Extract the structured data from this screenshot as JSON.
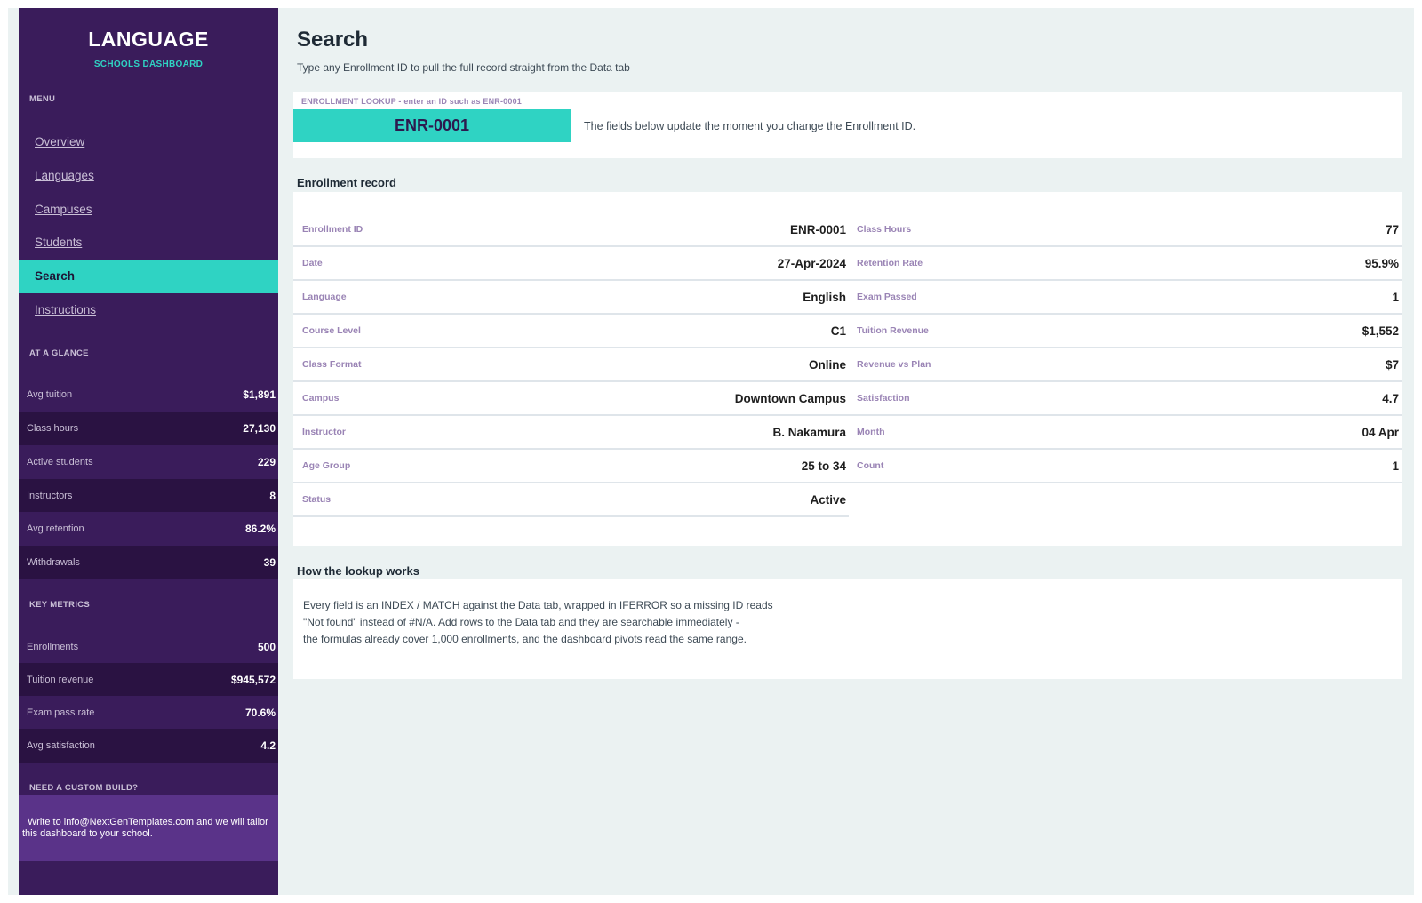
{
  "brand": {
    "title": "LANGUAGE",
    "subtitle": "SCHOOLS DASHBOARD"
  },
  "sidebar": {
    "menu_label": "MENU",
    "items": [
      {
        "label": "Overview"
      },
      {
        "label": "Languages"
      },
      {
        "label": "Campuses"
      },
      {
        "label": "Students"
      },
      {
        "label": "Search",
        "active": true
      },
      {
        "label": "Instructions"
      }
    ],
    "glance_label": "AT A GLANCE",
    "glance": [
      {
        "label": "Avg tuition",
        "value": "$1,891"
      },
      {
        "label": "Class hours",
        "value": "27,130"
      },
      {
        "label": "Active students",
        "value": "229"
      },
      {
        "label": "Instructors",
        "value": "8"
      },
      {
        "label": "Avg retention",
        "value": "86.2%"
      },
      {
        "label": "Withdrawals",
        "value": "39"
      }
    ],
    "metrics_label": "KEY METRICS",
    "metrics": [
      {
        "label": "Enrollments",
        "value": "500"
      },
      {
        "label": "Tuition revenue",
        "value": "$945,572"
      },
      {
        "label": "Exam pass rate",
        "value": "70.6%"
      },
      {
        "label": "Avg satisfaction",
        "value": "4.2"
      }
    ],
    "cta_label": "NEED A CUSTOM BUILD?",
    "cta_line1": "Write to info@NextGenTemplates.com and we will tailor",
    "cta_line2": "this dashboard to your school."
  },
  "main": {
    "title": "Search",
    "subtitle": "Type any Enrollment ID to pull the full record straight from the Data tab",
    "lookup": {
      "label": "ENROLLMENT LOOKUP  -  enter an ID such as ENR-0001",
      "value": "ENR-0001",
      "hint": "The fields below update the moment you change the Enrollment ID."
    },
    "record_title": "Enrollment record",
    "record_left": [
      {
        "label": "Enrollment ID",
        "value": "ENR-0001"
      },
      {
        "label": "Date",
        "value": "27-Apr-2024"
      },
      {
        "label": "Language",
        "value": "English"
      },
      {
        "label": "Course Level",
        "value": "C1"
      },
      {
        "label": "Class Format",
        "value": "Online"
      },
      {
        "label": "Campus",
        "value": "Downtown Campus"
      },
      {
        "label": "Instructor",
        "value": "B. Nakamura"
      },
      {
        "label": "Age Group",
        "value": "25 to 34"
      },
      {
        "label": "Status",
        "value": "Active"
      }
    ],
    "record_right": [
      {
        "label": "Class Hours",
        "value": "77"
      },
      {
        "label": "Retention Rate",
        "value": "95.9%"
      },
      {
        "label": "Exam Passed",
        "value": "1"
      },
      {
        "label": "Tuition Revenue",
        "value": "$1,552"
      },
      {
        "label": "Revenue vs Plan",
        "value": "$7"
      },
      {
        "label": "Satisfaction",
        "value": "4.7"
      },
      {
        "label": "Month",
        "value": "04 Apr"
      },
      {
        "label": "Count",
        "value": "1"
      }
    ],
    "how_title": "How the lookup works",
    "how_lines": [
      "Every field is an INDEX / MATCH against the Data tab, wrapped in IFERROR so a missing ID reads",
      "\"Not found\" instead of #N/A. Add rows to the Data tab and they are searchable immediately -",
      "the formulas already cover 1,000 enrollments, and the dashboard pivots read the same range."
    ]
  },
  "colors": {
    "sidebar": "#3a1c5b",
    "sidebar_alt": "#2a1242",
    "accent": "#2fd3c3",
    "cta": "#5a3389",
    "background": "#ebf2f2"
  }
}
